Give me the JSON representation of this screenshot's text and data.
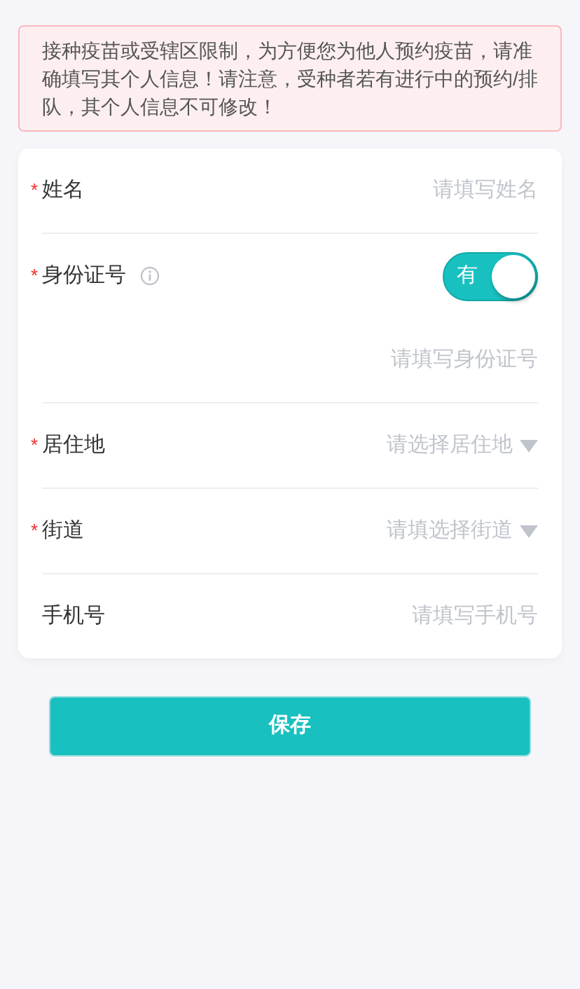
{
  "notice": "接种疫苗或受辖区限制，为方便您为他人预约疫苗，请准确填写其个人信息！请注意，受种者若有进行中的预约/排队，其个人信息不可修改！",
  "fields": [
    {
      "kind": "text",
      "required_mark": "*",
      "label": "姓名",
      "placeholder": "请填写姓名"
    },
    {
      "kind": "toggle",
      "required_mark": "*",
      "label": "身份证号",
      "info": true,
      "toggle": {
        "label": "有",
        "on": true
      },
      "placeholder": "请填写身份证号"
    },
    {
      "kind": "select",
      "required_mark": "*",
      "label": "居住地",
      "placeholder": "请选择居住地"
    },
    {
      "kind": "select",
      "required_mark": "*",
      "label": "街道",
      "placeholder": "请填选择街道"
    },
    {
      "kind": "text",
      "label": "手机号",
      "placeholder": "请填写手机号"
    }
  ],
  "save_button": "保存"
}
